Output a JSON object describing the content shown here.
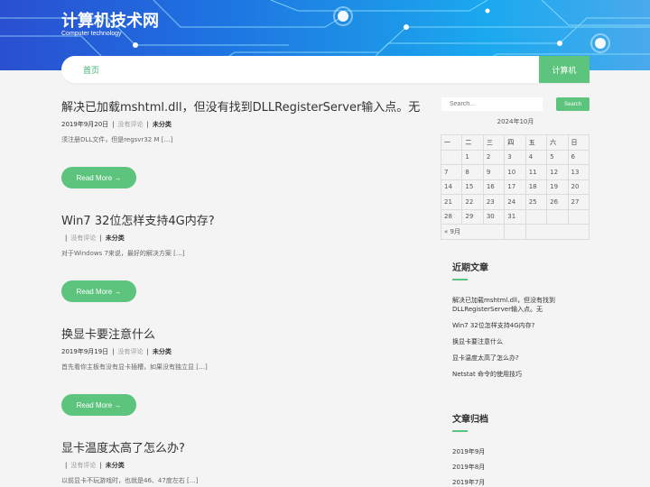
{
  "site": {
    "title": "计算机技术网",
    "subtitle": "Computer technology"
  },
  "nav": {
    "home_label": "首页",
    "right_label": "计算机"
  },
  "posts": [
    {
      "title": "解决已加载mshtml.dll，但没有找到DLLRegisterServer输入点。无",
      "date": "2019年9月20日",
      "comments": "没有评论",
      "category": "未分类",
      "excerpt": "须注册DLL文件，但是regsvr32 M […]",
      "read_more": "Read More →"
    },
    {
      "title": "Win7 32位怎样支持4G内存?",
      "date": "",
      "comments": "没有评论",
      "category": "未分类",
      "excerpt": "对于Windows 7来说，最好的解决方案 […]",
      "read_more": "Read More →"
    },
    {
      "title": "换显卡要注意什么",
      "date": "2019年9月19日",
      "comments": "没有评论",
      "category": "未分类",
      "excerpt": "首先看你主板有没有显卡插槽，如果没有独立显 […]",
      "read_more": "Read More →"
    },
    {
      "title": "显卡温度太高了怎么办?",
      "date": "",
      "comments": "没有评论",
      "category": "未分类",
      "excerpt": "以前显卡不玩游戏时，也就是46、47度左右 […]"
    }
  ],
  "sidebar": {
    "search_placeholder": "Search...",
    "search_button": "Search",
    "calendar": {
      "caption": "2024年10月",
      "weekdays": [
        "一",
        "二",
        "三",
        "四",
        "五",
        "六",
        "日"
      ],
      "rows": [
        [
          "",
          "1",
          "2",
          "3",
          "4",
          "5",
          "6"
        ],
        [
          "7",
          "8",
          "9",
          "10",
          "11",
          "12",
          "13"
        ],
        [
          "14",
          "15",
          "16",
          "17",
          "18",
          "19",
          "20"
        ],
        [
          "21",
          "22",
          "23",
          "24",
          "25",
          "26",
          "27"
        ],
        [
          "28",
          "29",
          "30",
          "31",
          "",
          "",
          ""
        ]
      ],
      "prev_link": "« 9月"
    },
    "recent_title": "近期文章",
    "recent_posts": [
      "解决已加载mshtml.dll，但没有找到DLLRegisterServer输入点。无",
      "Win7 32位怎样支持4G内存?",
      "换显卡要注意什么",
      "显卡温度太高了怎么办?",
      "Netstat 命令的使用技巧"
    ],
    "archive_title": "文章归档",
    "archives": [
      "2019年9月",
      "2019年8月",
      "2019年7月"
    ]
  },
  "colors": {
    "accent": "#5cc47c",
    "banner_left": "#2a4fd0",
    "banner_right": "#1aa9ef",
    "page_bg": "#f4f4f4"
  }
}
